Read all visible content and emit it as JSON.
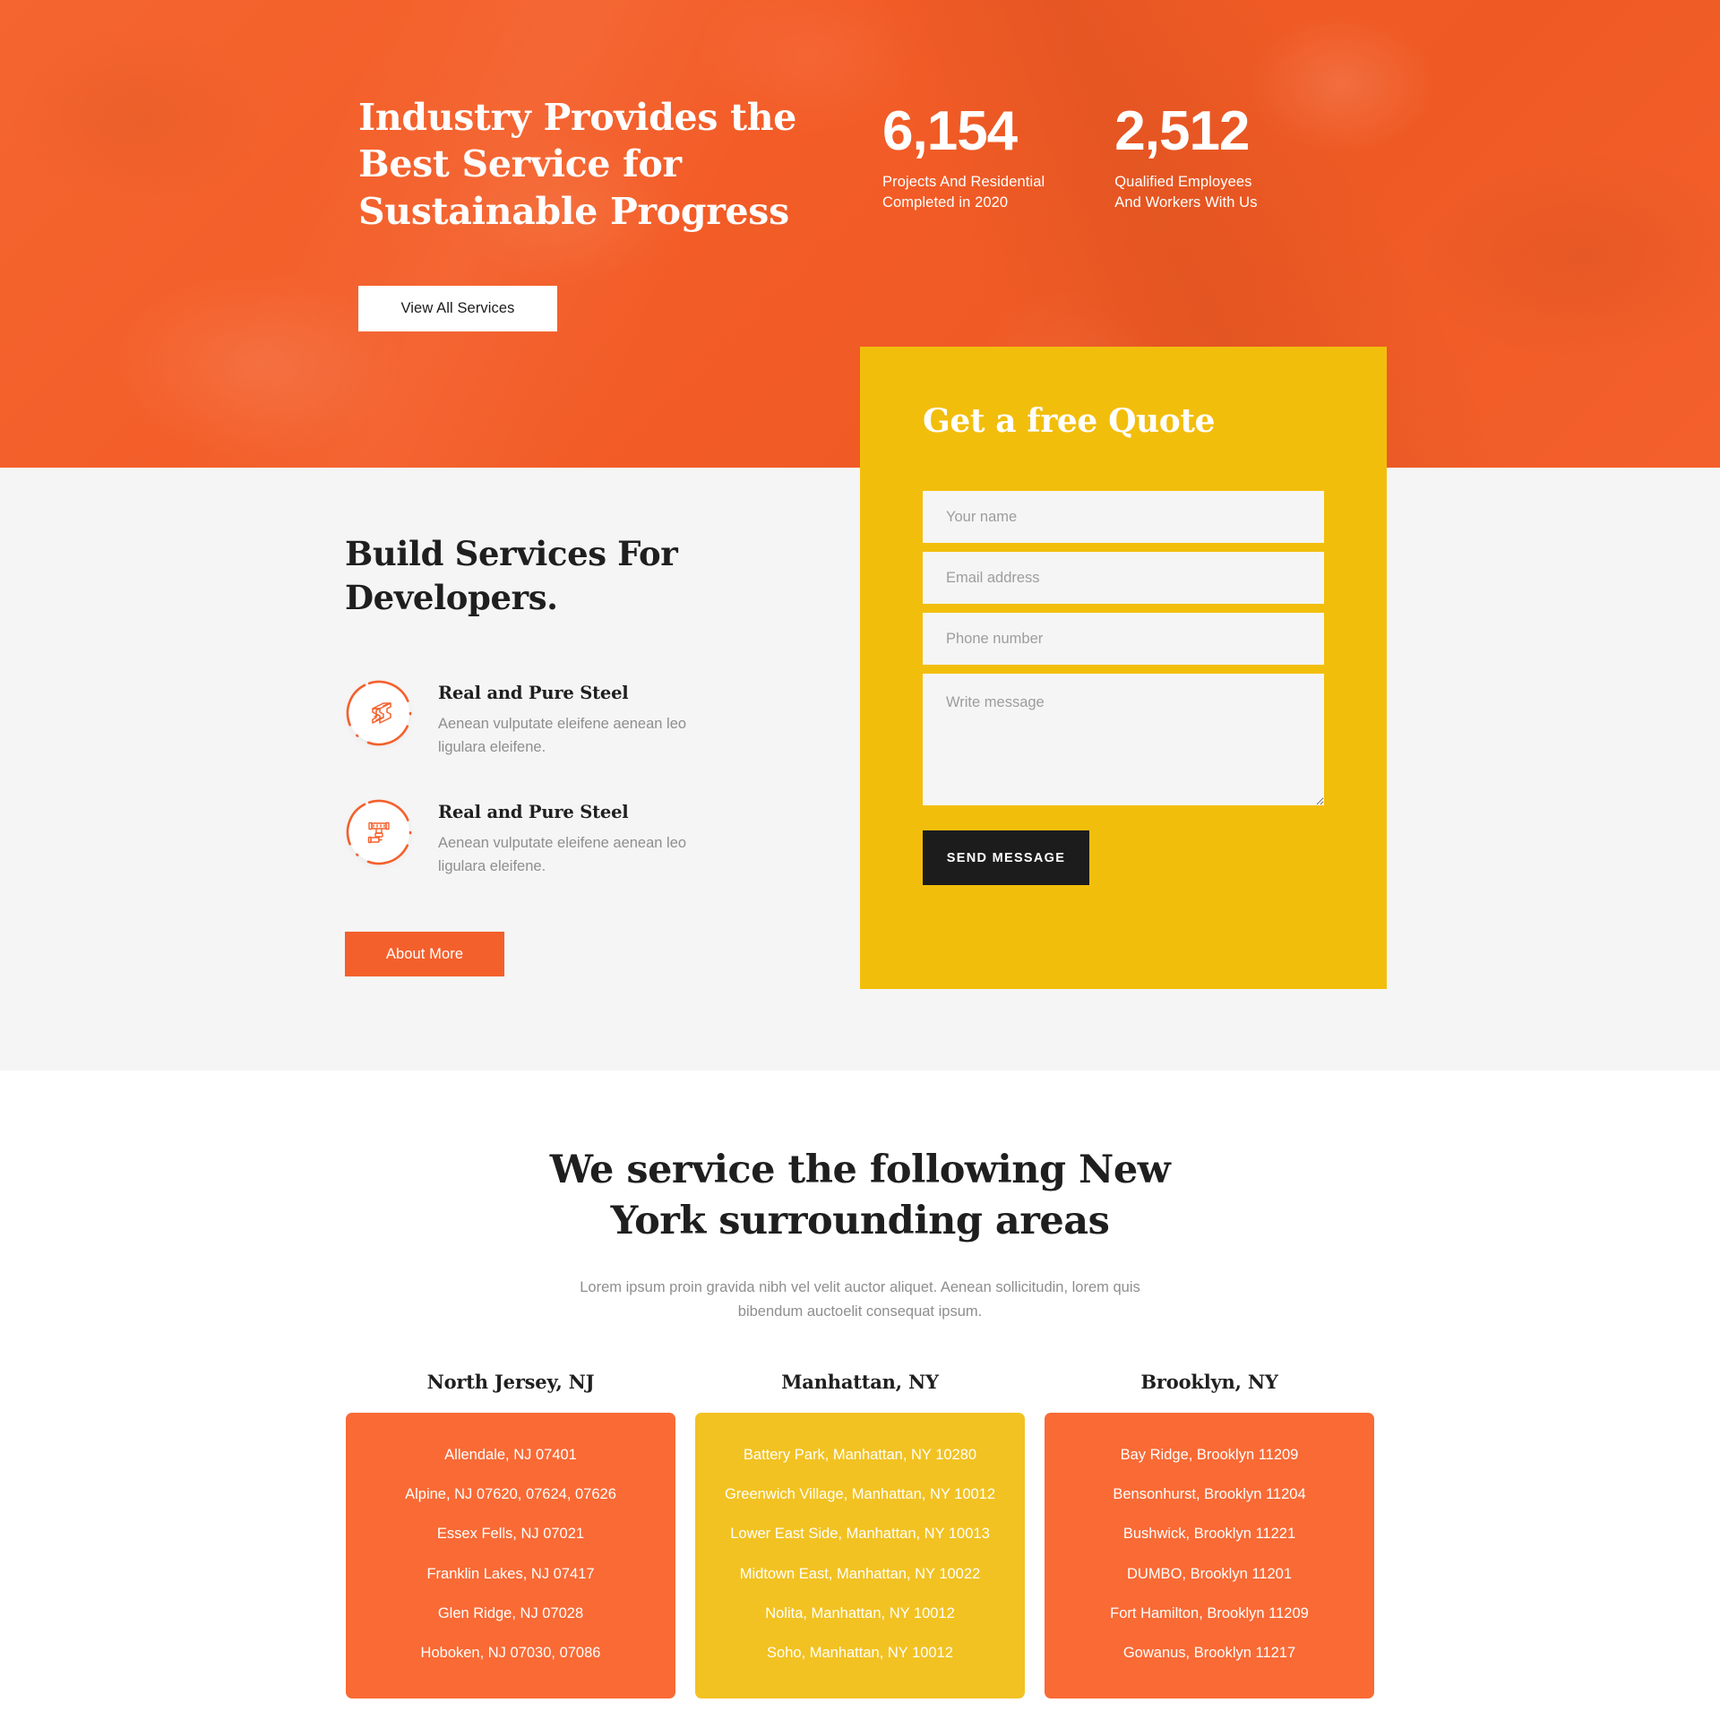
{
  "colors": {
    "brand_orange": "#f4602c",
    "card_orange": "#f96a35",
    "brand_yellow": "#f2be0c",
    "card_yellow": "#f2c222",
    "dark": "#1c1c1c",
    "muted_text": "#8e8e8e",
    "light_bg": "#f5f5f5"
  },
  "hero": {
    "title": "Industry Provides the Best Service for Sustainable Progress",
    "cta_label": "View All Services",
    "stats": [
      {
        "number": "6,154",
        "label": "Projects And Residential\nCompleted in 2020"
      },
      {
        "number": "2,512",
        "label": "Qualified Employees\nAnd Workers With Us"
      }
    ]
  },
  "build": {
    "title": "Build Services For Developers.",
    "about_label": "About More",
    "services": [
      {
        "icon": "steel-beam-icon",
        "name": "Real and Pure Steel",
        "desc": "Aenean vulputate eleifene aenean leo ligulara eleifene."
      },
      {
        "icon": "pipe-valve-icon",
        "name": "Real and Pure Steel",
        "desc": "Aenean vulputate eleifene aenean leo ligulara eleifene."
      }
    ]
  },
  "quote": {
    "title": "Get a free Quote",
    "fields": {
      "name_placeholder": "Your name",
      "name_value": "",
      "email_placeholder": "Email address",
      "email_value": "",
      "phone_placeholder": "Phone number",
      "phone_value": "",
      "message_placeholder": "Write message",
      "message_value": ""
    },
    "submit_label": "SEND MESSAGE"
  },
  "areas": {
    "title": "We service the following New York surrounding areas",
    "subtitle": "Lorem ipsum proin gravida nibh vel velit auctor aliquet. Aenean sollicitudin, lorem quis bibendum auctoelit consequat ipsum.",
    "columns": [
      {
        "heading": "North Jersey, NJ",
        "theme": "orange",
        "items": [
          "Allendale, NJ 07401",
          "Alpine, NJ 07620, 07624, 07626",
          "Essex Fells, NJ 07021",
          "Franklin Lakes, NJ 07417",
          "Glen Ridge, NJ 07028",
          "Hoboken, NJ 07030, 07086"
        ]
      },
      {
        "heading": "Manhattan, NY",
        "theme": "yellow",
        "items": [
          "Battery Park, Manhattan, NY 10280",
          "Greenwich Village, Manhattan, NY 10012",
          "Lower East Side, Manhattan, NY 10013",
          "Midtown East, Manhattan, NY 10022",
          "Nolita, Manhattan, NY 10012",
          "Soho, Manhattan, NY 10012"
        ]
      },
      {
        "heading": "Brooklyn, NY",
        "theme": "orange",
        "items": [
          "Bay Ridge, Brooklyn 11209",
          "Bensonhurst, Brooklyn 11204",
          "Bushwick, Brooklyn 11221",
          "DUMBO, Brooklyn 11201",
          "Fort Hamilton, Brooklyn 11209",
          "Gowanus, Brooklyn 11217"
        ]
      }
    ]
  }
}
